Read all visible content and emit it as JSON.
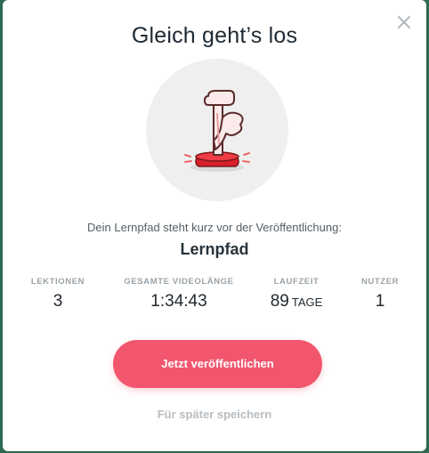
{
  "dialog": {
    "title": "Gleich geht’s los",
    "subtitle": "Dein Lernpfad steht kurz vor der Veröffentlichung:",
    "path_name": "Lernpfad",
    "close_icon": "close-icon",
    "illustration_icon": "plunger-detonator-icon"
  },
  "stats": [
    {
      "label": "LEKTIONEN",
      "value": "3",
      "unit": ""
    },
    {
      "label": "GESAMTE VIDEOLÄNGE",
      "value": "1:34:43",
      "unit": ""
    },
    {
      "label": "LAUFZEIT",
      "value": "89",
      "unit": "TAGE"
    },
    {
      "label": "NUTZER",
      "value": "1",
      "unit": ""
    }
  ],
  "actions": {
    "publish_label": "Jetzt veröffentlichen",
    "save_later_label": "Für später speichern"
  },
  "colors": {
    "accent": "#f2566e",
    "background_overlay": "#2c6b52"
  }
}
